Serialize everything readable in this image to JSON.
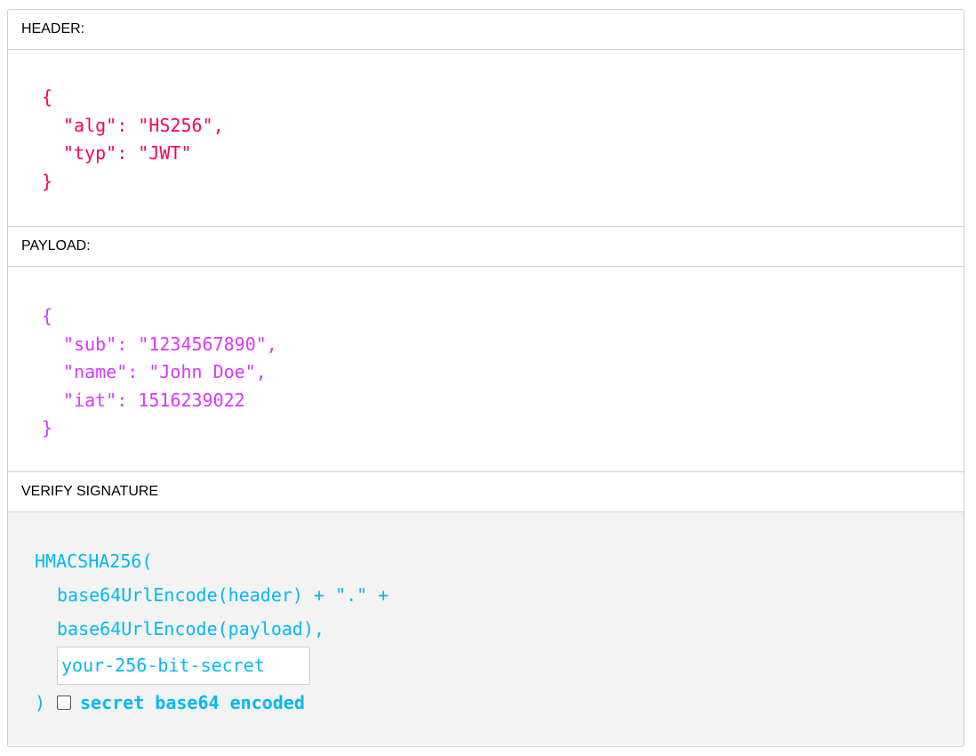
{
  "header": {
    "title": "HEADER:",
    "open_brace": "{",
    "lines": [
      "\"alg\": \"HS256\",",
      "\"typ\": \"JWT\""
    ],
    "close_brace": "}"
  },
  "payload": {
    "title": "PAYLOAD:",
    "open_brace": "{",
    "lines": [
      "\"sub\": \"1234567890\",",
      "\"name\": \"John Doe\",",
      "\"iat\": 1516239022"
    ],
    "close_brace": "}"
  },
  "verify": {
    "title": "VERIFY SIGNATURE",
    "func_open": "HMACSHA256(",
    "line1": "base64UrlEncode(header) + \".\" +",
    "line2": "base64UrlEncode(payload),",
    "secret_placeholder": "your-256-bit-secret",
    "secret_value": "",
    "close_paren": ")",
    "checkbox_label": "secret base64 encoded",
    "checkbox_checked": false
  },
  "colors": {
    "header_code": "#fb015b",
    "payload_code": "#d63aff",
    "signature_code": "#00b9f1",
    "signature_bg": "#f3f3f3",
    "border": "#d0d0d0"
  }
}
